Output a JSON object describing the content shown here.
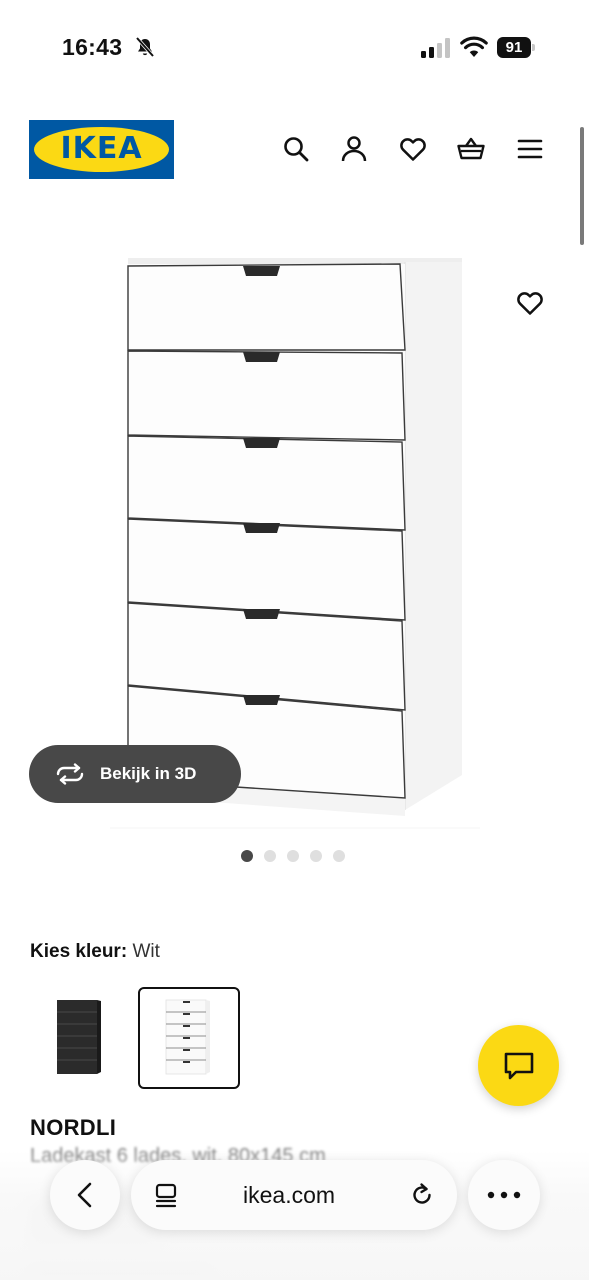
{
  "status_bar": {
    "time": "16:43",
    "battery": "91"
  },
  "header": {
    "logo_text": "IKEA",
    "icons": [
      "search-icon",
      "account-icon",
      "heart-icon",
      "basket-icon",
      "menu-icon"
    ]
  },
  "gallery": {
    "view_3d_label": "Bekijk in 3D",
    "dots_count": 5,
    "active_dot": 1
  },
  "color_selector": {
    "label": "Kies kleur:",
    "value": "Wit",
    "options": [
      "zwart",
      "wit"
    ],
    "selected": "wit"
  },
  "product": {
    "name": "NORDLI",
    "description": "Ladekast 6 lades, wit, 80x145 cm"
  },
  "browser": {
    "url": "ikea.com"
  },
  "colors": {
    "ikea_blue": "#0058a3",
    "ikea_yellow": "#fbd914",
    "pill_dark": "#484848"
  }
}
